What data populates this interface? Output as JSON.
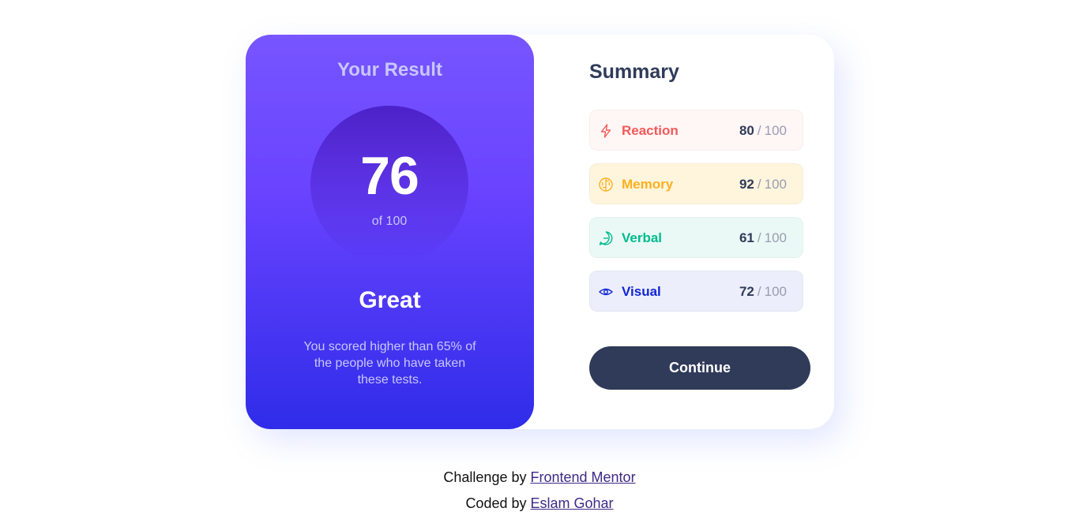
{
  "result": {
    "title": "Your Result",
    "score": "76",
    "of_label": "of 100",
    "rating": "Great",
    "description": "You scored higher than 65% of the people who have taken these tests."
  },
  "summary": {
    "title": "Summary",
    "items": [
      {
        "label": "Reaction",
        "score": "80",
        "max": "100",
        "icon": "lightning-icon",
        "color": "#f55959",
        "bg": "#fff6f6"
      },
      {
        "label": "Memory",
        "score": "92",
        "max": "100",
        "icon": "brain-icon",
        "color": "#ffb01f",
        "bg": "#fff5dd"
      },
      {
        "label": "Verbal",
        "score": "61",
        "max": "100",
        "icon": "chat-bubble-icon",
        "color": "#00bb8f",
        "bg": "#eaf9f5"
      },
      {
        "label": "Visual",
        "score": "72",
        "max": "100",
        "icon": "eye-icon",
        "color": "#1125d6",
        "bg": "#eceefb"
      }
    ],
    "continue_label": "Continue",
    "separator": "/"
  },
  "attribution": {
    "challenge_prefix": "Challenge by",
    "challenge_link": "Frontend Mentor",
    "coded_prefix": "Coded by",
    "coded_link": "Eslam Gohar"
  }
}
